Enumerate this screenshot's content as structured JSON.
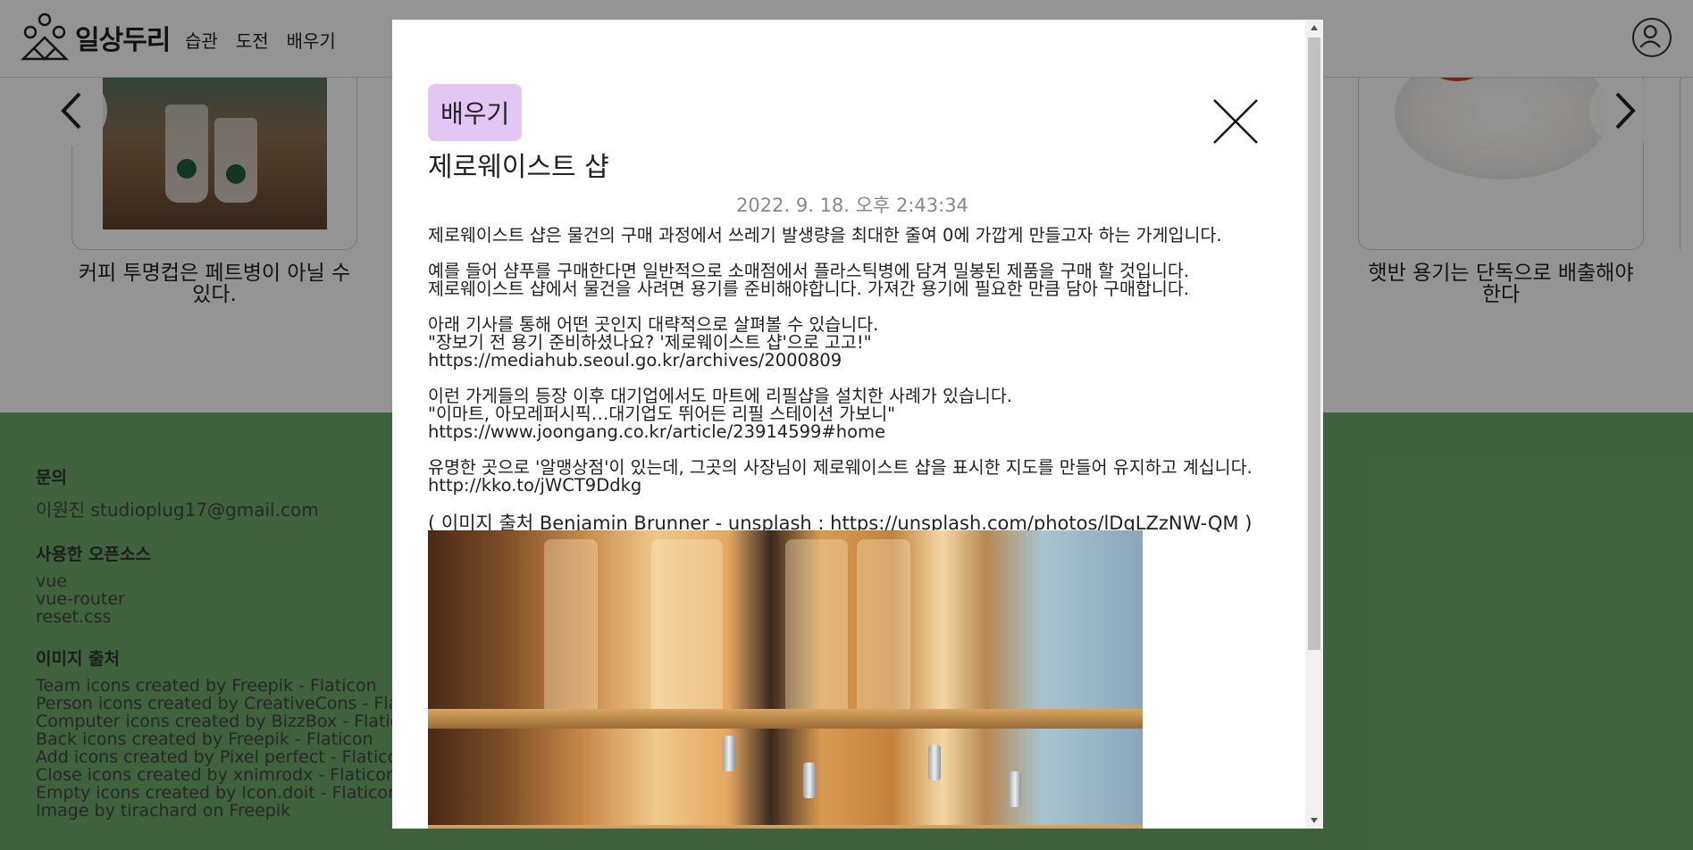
{
  "header": {
    "logo_text": "일상두리",
    "nav": [
      "습관",
      "도전",
      "배우기"
    ]
  },
  "cards": [
    {
      "caption": "커피 투명컵은 페트병이 아닐 수 있다."
    },
    {
      "caption": "햇반 용기는 단독으로 배출해야 한다"
    }
  ],
  "footer": {
    "contact_heading": "문의",
    "contact": "이원진 studioplug17@gmail.com",
    "oss_heading": "사용한 오픈소스",
    "oss": [
      "vue",
      "vue-router",
      "reset.css"
    ],
    "credits_heading": "이미지 출처",
    "credits": [
      "Team icons created by Freepik - Flaticon",
      "Person icons created by CreativeCons - Fla",
      "Computer icons created by BizzBox - Flatic",
      "Back icons created by Freepik - Flaticon",
      "Add icons created by Pixel perfect - Flatico",
      "Close icons created by xnimrodx - Flaticon",
      "Empty icons created by Icon.doit - Flaticon",
      "Image by tirachard on Freepik"
    ]
  },
  "modal": {
    "badge": "배우기",
    "title": "제로웨이스트 샵",
    "date": "2022. 9. 18. 오후 2:43:34",
    "paragraphs": [
      [
        "제로웨이스트 샵은 물건의 구매 과정에서 쓰레기 발생량을 최대한 줄여 0에 가깝게 만들고자 하는 가게입니다."
      ],
      [
        "예를 들어 샴푸를 구매한다면 일반적으로 소매점에서 플라스틱병에 담겨 밀봉된 제품을 구매 할 것입니다.",
        "제로웨이스트 샵에서 물건을 사려면 용기를 준비해야합니다. 가져간 용기에 필요한 만큼 담아 구매합니다."
      ],
      [
        "아래 기사를 통해 어떤 곳인지 대략적으로 살펴볼 수 있습니다.",
        "\"장보기 전 용기 준비하셨나요? '제로웨이스트 샵'으로 고고!\"",
        "https://mediahub.seoul.go.kr/archives/2000809"
      ],
      [
        "이런 가게들의 등장 이후 대기업에서도 마트에 리필샵을 설치한 사례가 있습니다.",
        "\"이마트, 아모레퍼시픽…대기업도 뛰어든 리필 스테이션 가보니\"",
        "https://www.joongang.co.kr/article/23914599#home"
      ],
      [
        "유명한 곳으로 '알맹상점'이 있는데, 그곳의 사장님이 제로웨이스트 샵을 표시한 지도를 만들어 유지하고 계십니다.",
        "http://kko.to/jWCT9Ddkg"
      ]
    ],
    "image_credit": "( 이미지 출처 Benjamin Brunner - unsplash : https://unsplash.com/photos/lDqLZzNW-QM )"
  }
}
